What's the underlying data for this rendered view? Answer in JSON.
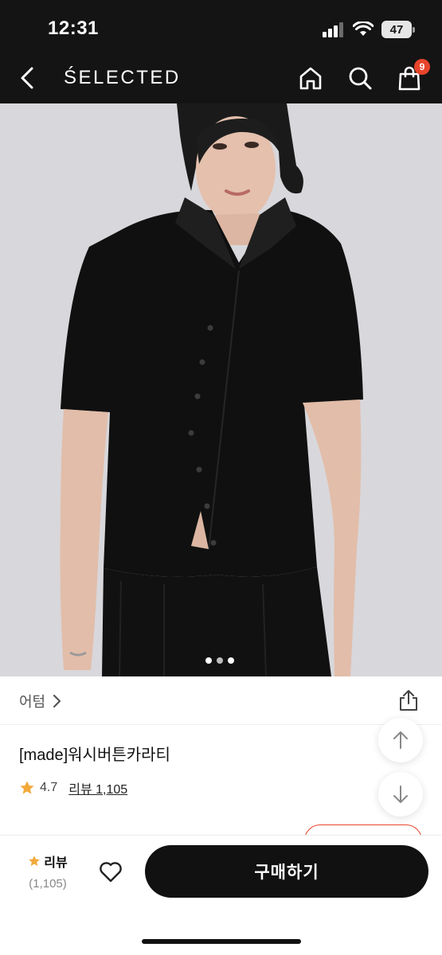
{
  "status_bar": {
    "time": "12:31",
    "battery": "47"
  },
  "header": {
    "title": "ŚELECTED",
    "cart_count": "9",
    "icons": [
      "back-icon",
      "home-icon",
      "search-icon",
      "cart-icon"
    ]
  },
  "gallery": {
    "total": 3,
    "active": 1
  },
  "product": {
    "brand": "어텀",
    "name": "[made]워시버튼카라티",
    "rating": "4.7",
    "review_label": "리뷰 1,105"
  },
  "bottom_bar": {
    "review_label": "리뷰",
    "review_count": "(1,105)",
    "buy_label": "구매하기"
  },
  "colors": {
    "header_bg": "#141414",
    "accent": "#e8452b",
    "star": "#f2a93b",
    "button_bg": "#111111"
  }
}
